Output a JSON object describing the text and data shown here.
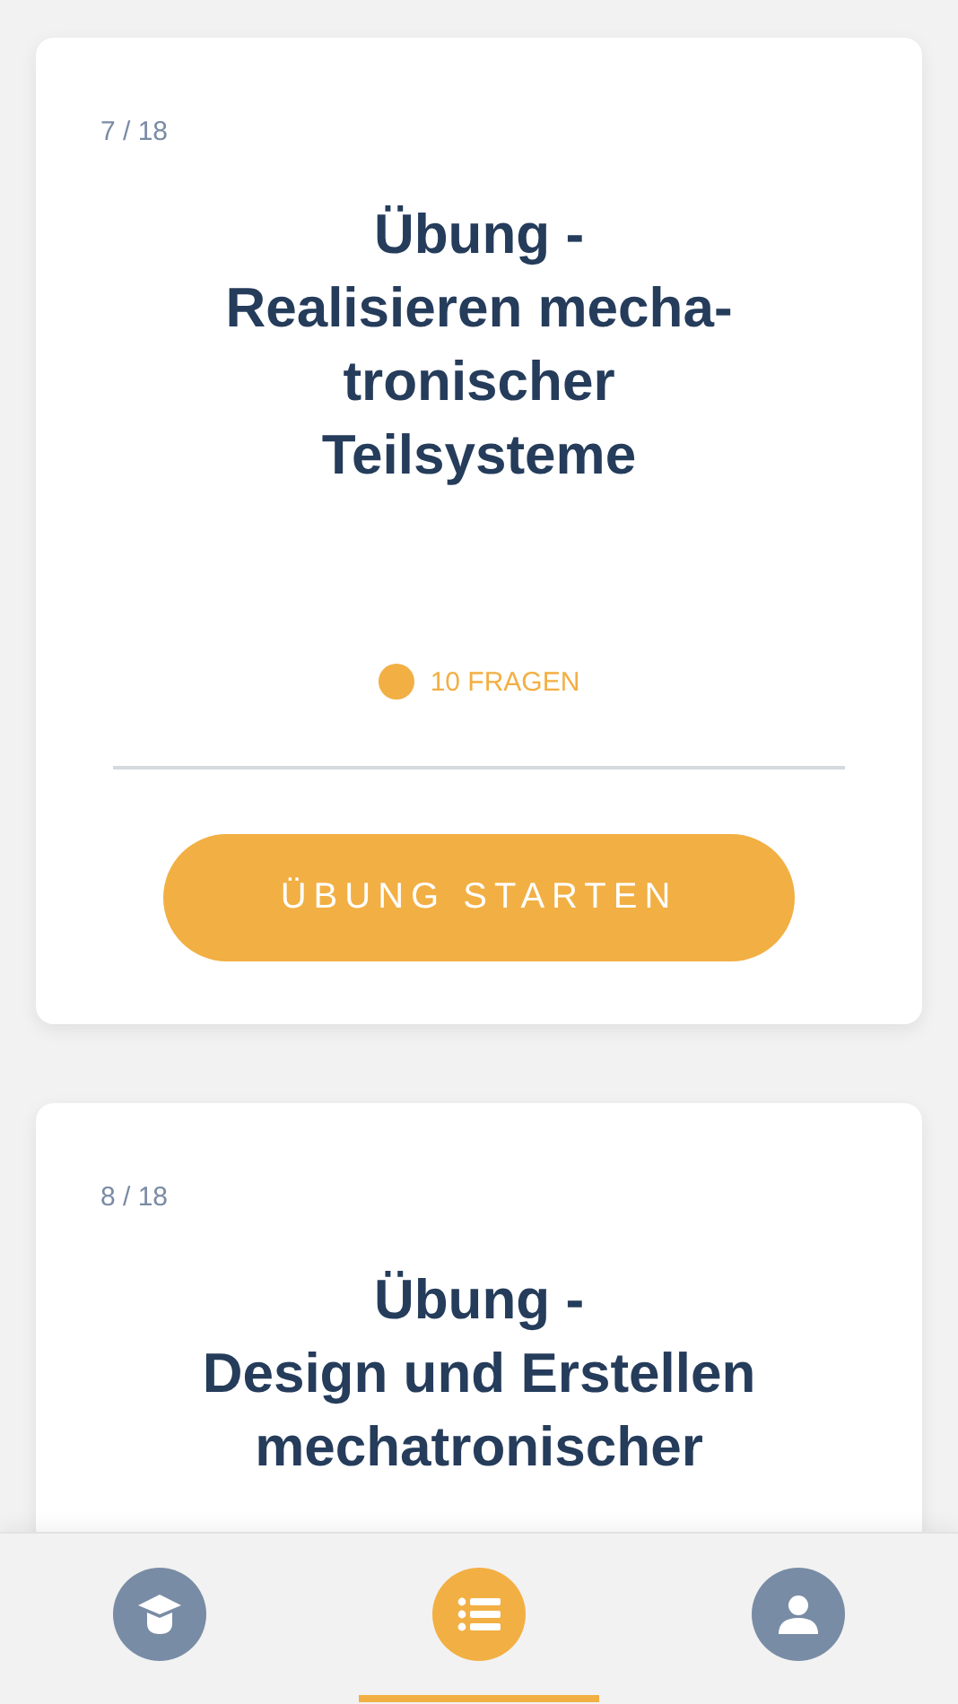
{
  "cards": [
    {
      "counter": "7 / 18",
      "title_lines": [
        "Übung -",
        "Realisieren mecha-",
        "tronischer",
        "Teilsysteme"
      ],
      "question_count": "10 FRAGEN",
      "button": "ÜBUNG STARTEN"
    },
    {
      "counter": "8 / 18",
      "title_lines": [
        "Übung -",
        "Design und Erstellen",
        "mechatronischer"
      ]
    }
  ],
  "nav": [
    {
      "kind": "course",
      "selected": false
    },
    {
      "kind": "list",
      "selected": true
    },
    {
      "kind": "profile",
      "selected": false
    }
  ]
}
